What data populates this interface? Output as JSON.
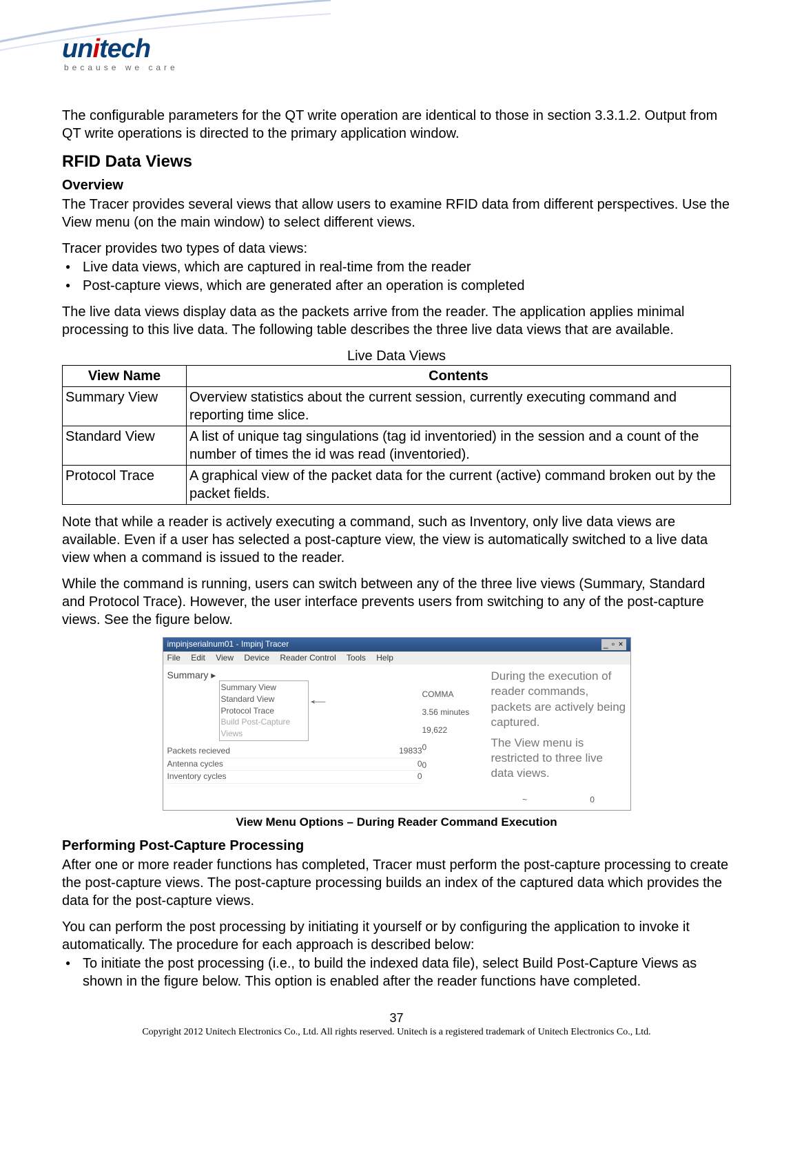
{
  "logo": {
    "name": "unitech",
    "tagline": "because we care"
  },
  "intro_paragraph": "The configurable parameters for the QT write operation are identical to those in section 3.3.1.2. Output from QT write operations is directed to the primary application window.",
  "section_heading": "RFID Data Views",
  "overview_heading": "Overview",
  "overview_text": "The Tracer provides several views that allow users to examine RFID data from different perspectives. Use the View menu (on the main window) to select different views.",
  "types_intro": "Tracer provides two types of data views:",
  "types_bullets": [
    "Live data views, which are captured in real-time from the reader",
    "Post-capture views, which are generated after an operation is completed"
  ],
  "live_paragraph": "The live data views display data as the packets arrive from the reader. The application applies minimal processing to this live data. The following table describes the three live data views that are available.",
  "table": {
    "caption": "Live Data Views",
    "headers": [
      "View Name",
      "Contents"
    ],
    "rows": [
      [
        "Summary View",
        "Overview statistics about the current session, currently executing command and reporting time slice."
      ],
      [
        "Standard View",
        "A list of unique tag singulations (tag id inventoried) in the session and a count of the number of times the id was read (inventoried)."
      ],
      [
        "Protocol Trace",
        "A graphical view of the packet data for the current (active) command broken out by the packet fields."
      ]
    ]
  },
  "note_paragraph": "Note that while a reader is actively executing a command, such as Inventory, only live data views are available. Even if a user has selected a post-capture view, the view is automatically switched to a live data view when a command is issued to the reader.",
  "while_paragraph": "While the command is running, users can switch between any of the three live views (Summary, Standard and Protocol Trace). However, the user interface prevents users from switching to any of the post-capture views. See the figure below.",
  "figure": {
    "window_title": "impinjserialnum01 - Impinj Tracer",
    "window_buttons": "_ ▫ ×",
    "menubar": [
      "File",
      "Edit",
      "View",
      "Device",
      "Reader Control",
      "Tools",
      "Help"
    ],
    "active_tab": "Summary",
    "dropdown_items": [
      "Summary View",
      "Standard View",
      "Protocol Trace"
    ],
    "dropdown_disabled": "Build Post-Capture Views",
    "stat_rows": [
      {
        "label": "Packets recieved",
        "value": "19833"
      },
      {
        "label": "Antenna cycles",
        "value": "0"
      },
      {
        "label": "Inventory cycles",
        "value": "0"
      }
    ],
    "center_values": [
      "COMMA",
      "3.56 minutes",
      "19,622",
      "0",
      "0"
    ],
    "annotation1": "During the execution of reader commands, packets are actively being captured.",
    "annotation2": "The View menu is restricted to   three live data views.",
    "right_extras": [
      "~",
      "0"
    ],
    "caption": "View Menu Options – During Reader Command Execution"
  },
  "postcapture_heading": "Performing Post-Capture Processing",
  "postcapture_text": "After one or more reader functions has completed, Tracer must perform the post-capture processing to create the post-capture views. The post-capture processing builds an index of the captured data which provides the data for the post-capture views.",
  "postprocess_paragraph": "You can perform the post processing by initiating it yourself or by configuring the application to invoke it automatically. The procedure for each approach is described below:",
  "postprocess_bullet": "To initiate the post processing (i.e., to build the indexed data file), select Build Post-Capture Views as shown in the figure below. This option is enabled after the reader functions have completed.",
  "page_number": "37",
  "copyright": "Copyright 2012 Unitech Electronics Co., Ltd. All rights reserved. Unitech is a registered trademark of Unitech Electronics Co., Ltd."
}
